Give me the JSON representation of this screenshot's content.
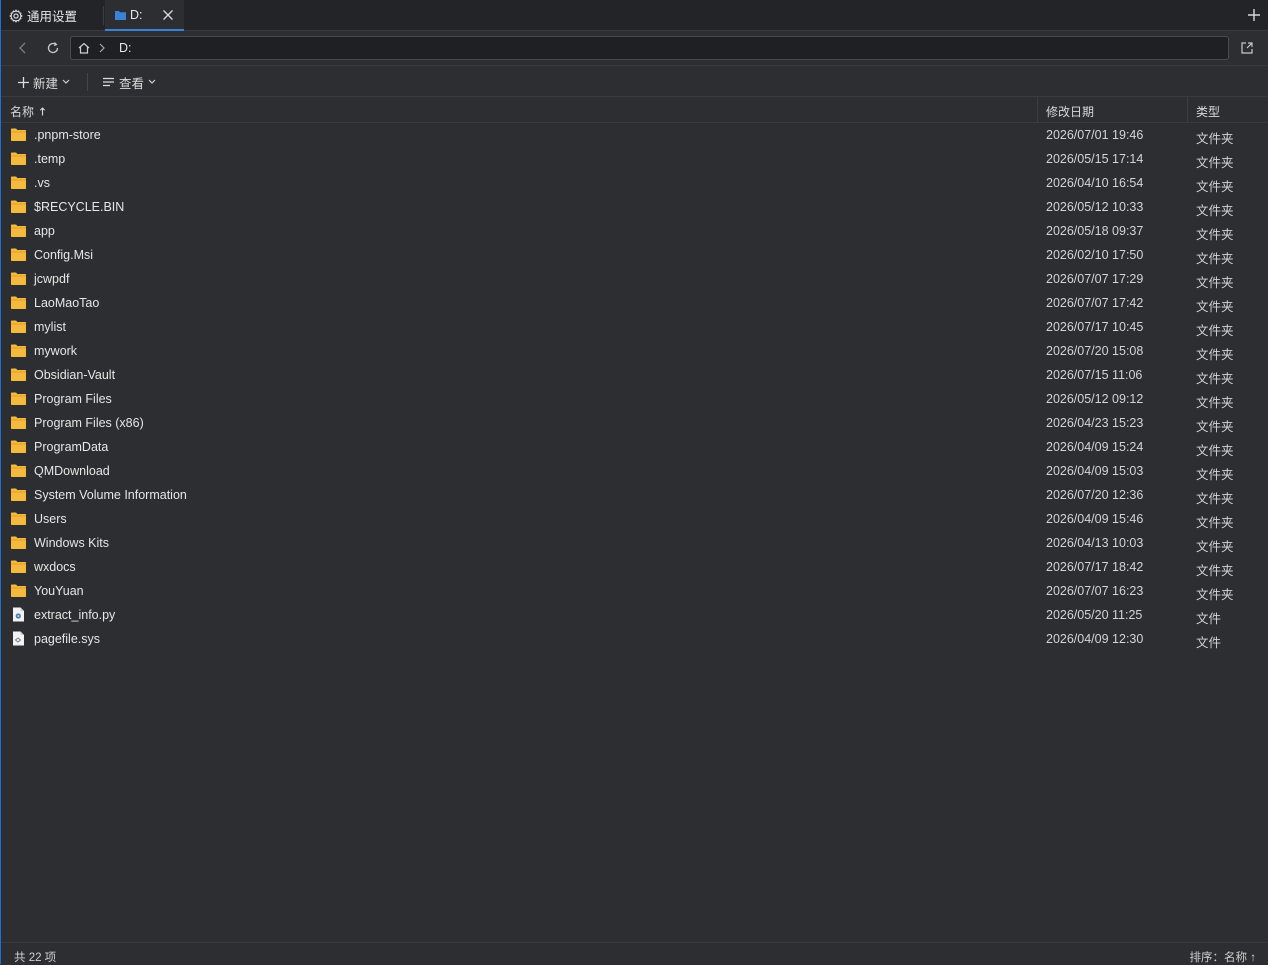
{
  "tabs": {
    "settings_label": "通用设置",
    "drive_label": "D:"
  },
  "address": {
    "path": "D:"
  },
  "toolbar": {
    "new_label": "新建",
    "view_label": "查看"
  },
  "columns": {
    "name": "名称",
    "modified": "修改日期",
    "type": "类型"
  },
  "files": [
    {
      "name": ".pnpm-store",
      "modified": "2026/07/01 19:46",
      "type": "文件夹",
      "icon": "folder-icon"
    },
    {
      "name": ".temp",
      "modified": "2026/05/15 17:14",
      "type": "文件夹",
      "icon": "folder-icon"
    },
    {
      "name": ".vs",
      "modified": "2026/04/10 16:54",
      "type": "文件夹",
      "icon": "folder-icon"
    },
    {
      "name": "$RECYCLE.BIN",
      "modified": "2026/05/12 10:33",
      "type": "文件夹",
      "icon": "folder-icon"
    },
    {
      "name": "app",
      "modified": "2026/05/18 09:37",
      "type": "文件夹",
      "icon": "folder-icon"
    },
    {
      "name": "Config.Msi",
      "modified": "2026/02/10 17:50",
      "type": "文件夹",
      "icon": "folder-icon"
    },
    {
      "name": "jcwpdf",
      "modified": "2026/07/07 17:29",
      "type": "文件夹",
      "icon": "folder-icon"
    },
    {
      "name": "LaoMaoTao",
      "modified": "2026/07/07 17:42",
      "type": "文件夹",
      "icon": "folder-icon"
    },
    {
      "name": "mylist",
      "modified": "2026/07/17 10:45",
      "type": "文件夹",
      "icon": "folder-icon"
    },
    {
      "name": "mywork",
      "modified": "2026/07/20 15:08",
      "type": "文件夹",
      "icon": "folder-icon"
    },
    {
      "name": "Obsidian-Vault",
      "modified": "2026/07/15 11:06",
      "type": "文件夹",
      "icon": "folder-icon"
    },
    {
      "name": "Program Files",
      "modified": "2026/05/12 09:12",
      "type": "文件夹",
      "icon": "folder-icon"
    },
    {
      "name": "Program Files (x86)",
      "modified": "2026/04/23 15:23",
      "type": "文件夹",
      "icon": "folder-icon"
    },
    {
      "name": "ProgramData",
      "modified": "2026/04/09 15:24",
      "type": "文件夹",
      "icon": "folder-icon"
    },
    {
      "name": "QMDownload",
      "modified": "2026/04/09 15:03",
      "type": "文件夹",
      "icon": "folder-icon"
    },
    {
      "name": "System Volume Information",
      "modified": "2026/07/20 12:36",
      "type": "文件夹",
      "icon": "folder-icon"
    },
    {
      "name": "Users",
      "modified": "2026/04/09 15:46",
      "type": "文件夹",
      "icon": "folder-icon"
    },
    {
      "name": "Windows Kits",
      "modified": "2026/04/13 10:03",
      "type": "文件夹",
      "icon": "folder-icon"
    },
    {
      "name": "wxdocs",
      "modified": "2026/07/17 18:42",
      "type": "文件夹",
      "icon": "folder-icon"
    },
    {
      "name": "YouYuan",
      "modified": "2026/07/07 16:23",
      "type": "文件夹",
      "icon": "folder-icon"
    },
    {
      "name": "extract_info.py",
      "modified": "2026/05/20 11:25",
      "type": "文件",
      "icon": "python-file-icon"
    },
    {
      "name": "pagefile.sys",
      "modified": "2026/04/09 12:30",
      "type": "文件",
      "icon": "file-icon"
    }
  ],
  "status": {
    "count": "共 22 项",
    "sort": "排序：名称 ↑"
  },
  "colors": {
    "background": "#2d2e31",
    "folder": "#f5b93b",
    "accent": "#3a82d6"
  }
}
